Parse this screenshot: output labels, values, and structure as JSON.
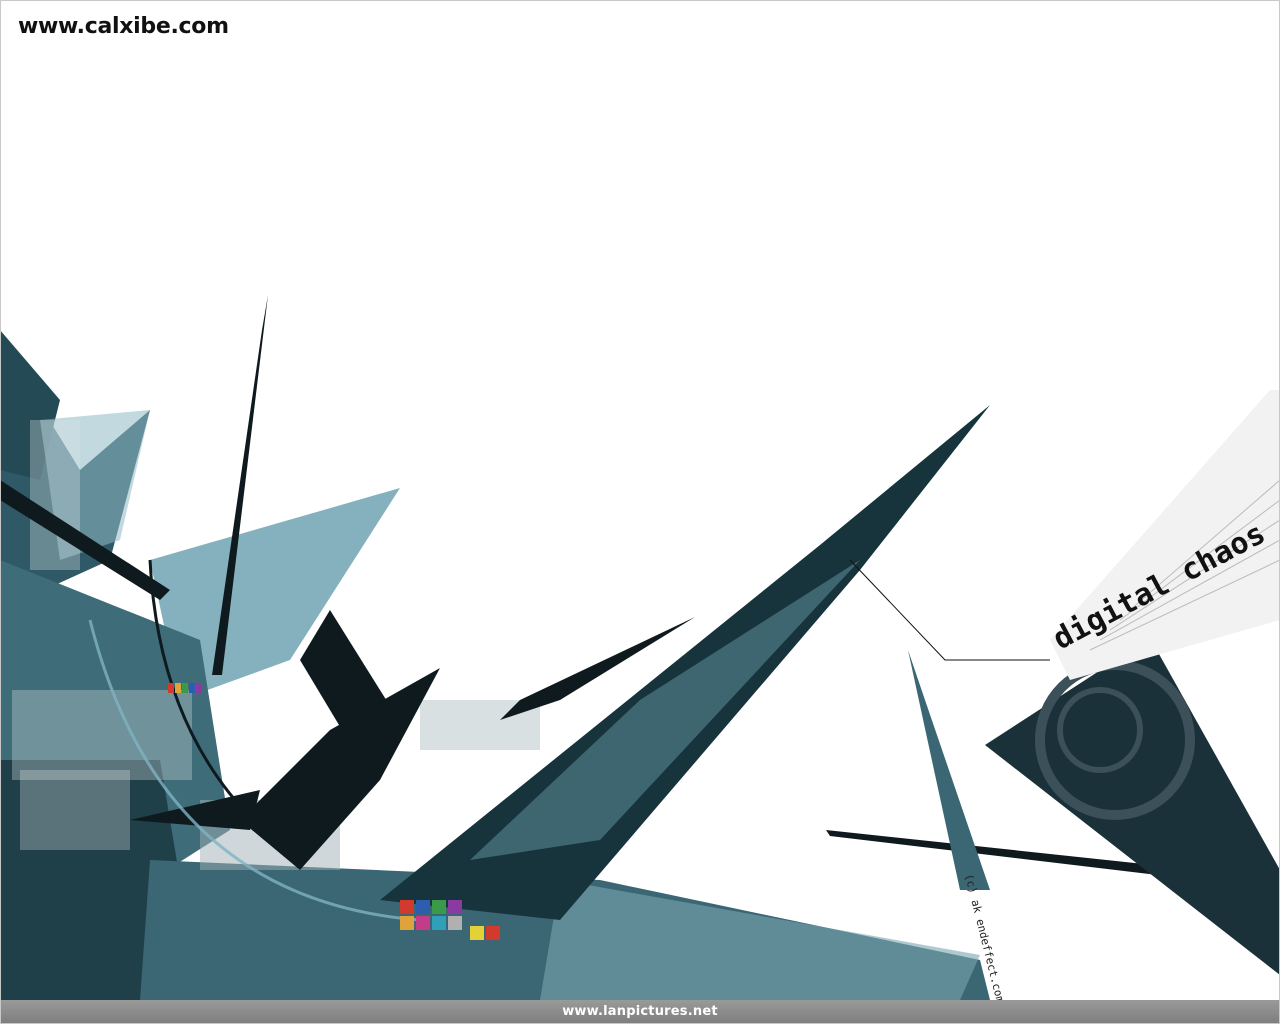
{
  "watermark_top": "www.calxibe.com",
  "watermark_bottom": "www.lanpictures.net",
  "art_title": "digital chaos",
  "art_credit": "(c) ak endeffect.com",
  "colors": {
    "background": "#ffffff",
    "teal_dark": "#1d3a44",
    "teal_mid": "#3f6f7c",
    "teal_light": "#7fb3c2",
    "ink": "#0f1a1f",
    "bar": "#8a8a8a"
  }
}
